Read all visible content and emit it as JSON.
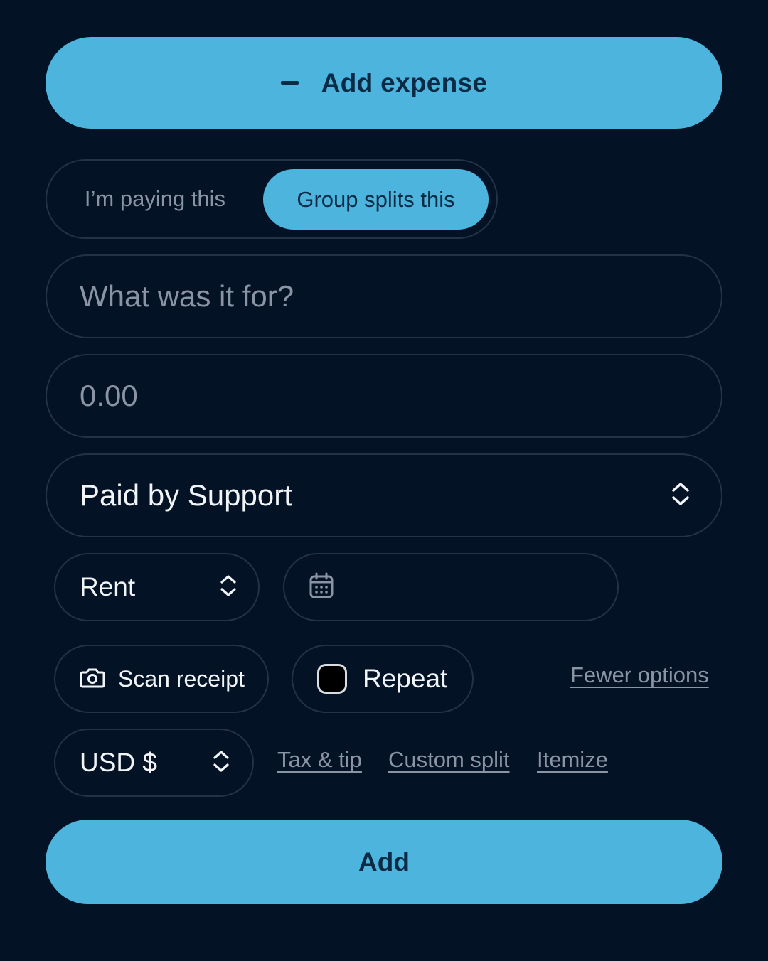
{
  "header": {
    "toggle_icon": "minus-icon",
    "title": "Add expense"
  },
  "mode_toggle": {
    "options": [
      "I’m paying this",
      "Group splits this"
    ],
    "selected": "Group splits this"
  },
  "form": {
    "description_placeholder": "What was it for?",
    "amount_placeholder": "0.00",
    "paid_by": "Paid by Support",
    "category": "Rent",
    "date_icon": "calendar-icon",
    "scan_receipt_label": "Scan receipt",
    "scan_icon": "camera-icon",
    "repeat_label": "Repeat",
    "repeat_checked": false,
    "fewer_options_label": "Fewer options",
    "currency": "USD $",
    "links": {
      "tax_tip": "Tax & tip",
      "custom_split": "Custom split",
      "itemize": "Itemize"
    }
  },
  "submit_label": "Add",
  "colors": {
    "background": "#041226",
    "accent": "#4db5dd",
    "accent_text": "#0a2a45",
    "border": "#243246",
    "muted_text": "#8a94a4"
  }
}
